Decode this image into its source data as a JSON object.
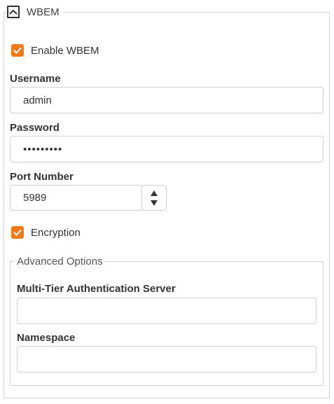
{
  "section": {
    "title": "WBEM"
  },
  "enable_wbem": {
    "label": "Enable WBEM",
    "checked": true
  },
  "username": {
    "label": "Username",
    "value": "admin"
  },
  "password": {
    "label": "Password",
    "value": "•••••••••"
  },
  "port": {
    "label": "Port Number",
    "value": "5989"
  },
  "encryption": {
    "label": "Encryption",
    "checked": true
  },
  "advanced": {
    "title": "Advanced Options",
    "auth_server": {
      "label": "Multi-Tier Authentication Server",
      "value": ""
    },
    "namespace": {
      "label": "Namespace",
      "value": ""
    }
  },
  "colors": {
    "accent": "#f07a18",
    "border": "#cfcfcf"
  },
  "icons": {
    "collapse": "chevron-up-icon",
    "checkmark": "checkmark-icon",
    "spin_up": "triangle-up-icon",
    "spin_down": "triangle-down-icon"
  }
}
